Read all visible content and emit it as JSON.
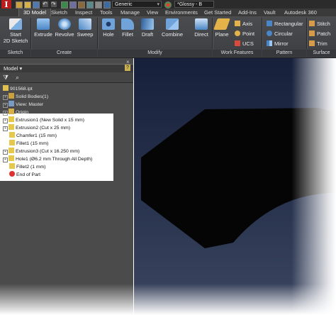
{
  "app": {
    "logo_letter": "I"
  },
  "title_bar": {
    "appearance_dropdown": "Generic",
    "material_dropdown": "*Glossy - B"
  },
  "menu_tabs": [
    "3D Model",
    "Sketch",
    "Inspect",
    "Tools",
    "Manage",
    "View",
    "Environments",
    "Get Started",
    "Add-Ins",
    "Vault",
    "Autodesk 360"
  ],
  "active_tab": "3D Model",
  "ribbon": {
    "sketch": {
      "start_line1": "Start",
      "start_line2": "2D Sketch",
      "group": "Sketch"
    },
    "create": {
      "extrude": "Extrude",
      "revolve": "Revolve",
      "sweep": "Sweep",
      "group": "Create"
    },
    "modify": {
      "hole": "Hole",
      "fillet": "Fillet",
      "draft": "Draft",
      "combine": "Combine",
      "direct": "Direct",
      "group": "Modify"
    },
    "work_features": {
      "plane": "Plane",
      "axis": "Axis",
      "point": "Point",
      "ucs": "UCS",
      "group": "Work Features"
    },
    "pattern": {
      "rectangular": "Rectangular",
      "circular": "Circular",
      "mirror": "Mirror",
      "group": "Pattern"
    },
    "surface": {
      "stitch": "Stitch",
      "patch": "Patch",
      "trim": "Trim",
      "group": "Surface"
    }
  },
  "browser": {
    "title": "Model",
    "help": "?",
    "close": "×",
    "tree": [
      {
        "label": "901568.ipt"
      },
      {
        "label": "Solid Bodies(1)"
      },
      {
        "label": "View: Master"
      },
      {
        "label": "Origin"
      },
      {
        "label": "Extrusion1 (New Solid x 15 mm)"
      },
      {
        "label": "Extrusion2 (Cut x 25 mm)"
      },
      {
        "label": "Chamfer1 (15 mm)"
      },
      {
        "label": "Fillet1 (15 mm)"
      },
      {
        "label": "Extrusion3 (Cut x 16.250 mm)"
      },
      {
        "label": "Hole1 (Ø6.2 mm Through All Depth)"
      },
      {
        "label": "Fillet2 (1 mm)"
      },
      {
        "label": "End of Part"
      }
    ]
  },
  "colors": {
    "highlight_bg": "#ffffff",
    "viewport_top": "#17203a",
    "part_color": "#050505",
    "logo_red": "#b81e1e"
  }
}
